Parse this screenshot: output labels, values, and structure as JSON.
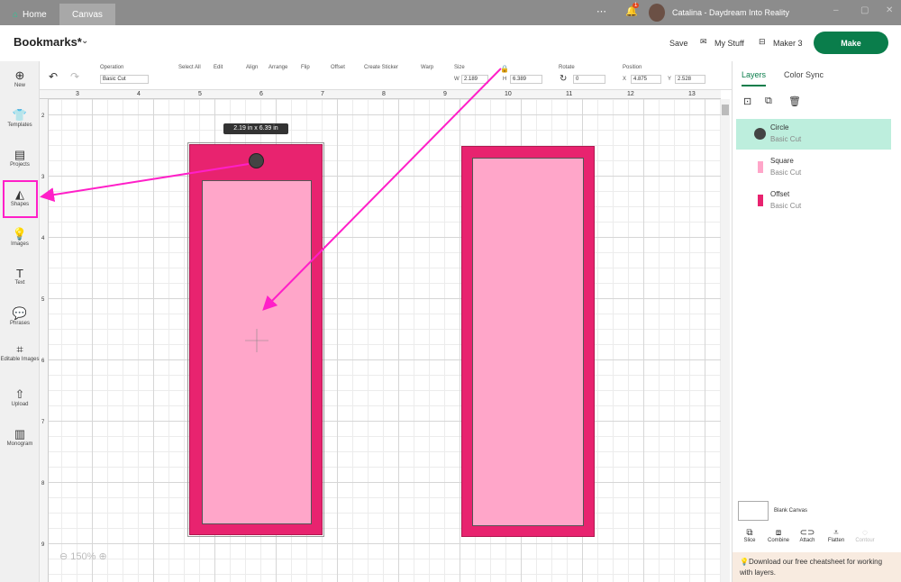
{
  "titlebar": {
    "tabs": [
      "Home",
      "Canvas"
    ],
    "notifications": "1",
    "user": "Catalina - Daydream Into Reality"
  },
  "header": {
    "project": "Bookmarks*",
    "save": "Save",
    "my_stuff": "My Stuff",
    "machine": "Maker 3",
    "make": "Make"
  },
  "toolbar": {
    "operation_label": "Operation",
    "operation_value": "Basic Cut",
    "select_all": "Select All",
    "edit": "Edit",
    "align": "Align",
    "arrange": "Arrange",
    "flip": "Flip",
    "offset": "Offset",
    "create_sticker": "Create Sticker",
    "warp": "Warp",
    "size": "Size",
    "w_label": "W",
    "w": "2.189",
    "h_label": "H",
    "h": "6.389",
    "rotate": "Rotate",
    "rotate_value": "0",
    "position": "Position",
    "x_label": "X",
    "x": "4.875",
    "y_label": "Y",
    "y": "2.528"
  },
  "sidebar": [
    {
      "label": "New",
      "icon": "⊕"
    },
    {
      "label": "Templates",
      "icon": "👕"
    },
    {
      "label": "Projects",
      "icon": "▤"
    },
    {
      "label": "Shapes",
      "icon": "◭"
    },
    {
      "label": "Images",
      "icon": "💡"
    },
    {
      "label": "Text",
      "icon": "T"
    },
    {
      "label": "Phrases",
      "icon": "💬"
    },
    {
      "label": "Editable Images",
      "icon": "⌗"
    },
    {
      "label": "Upload",
      "icon": "⇧"
    },
    {
      "label": "Monogram",
      "icon": "▥"
    }
  ],
  "ruler": {
    "top": [
      "3",
      "4",
      "5",
      "6",
      "7",
      "8",
      "9",
      "10",
      "11",
      "12",
      "13"
    ],
    "left": [
      "2",
      "3",
      "4",
      "5",
      "6",
      "7",
      "8",
      "9"
    ]
  },
  "canvas": {
    "size_tooltip": "2.19  in x 6.39  in",
    "zoom": "150%",
    "colors": {
      "offset": "#e8236f",
      "square": "#ffa6c9",
      "circle": "#444444",
      "arrow": "#ff1fc8"
    }
  },
  "panel": {
    "tabs": [
      "Layers",
      "Color Sync"
    ],
    "layers": [
      {
        "name": "Circle",
        "op": "Basic Cut",
        "color": "#444444"
      },
      {
        "name": "Square",
        "op": "Basic Cut",
        "color": "#ffa6c9"
      },
      {
        "name": "Offset",
        "op": "Basic Cut",
        "color": "#e8236f"
      }
    ],
    "blank_canvas": "Blank Canvas",
    "actions": [
      "Slice",
      "Combine",
      "Attach",
      "Flatten",
      "Contour"
    ],
    "tip": "Download our free cheatsheet for working with layers."
  }
}
